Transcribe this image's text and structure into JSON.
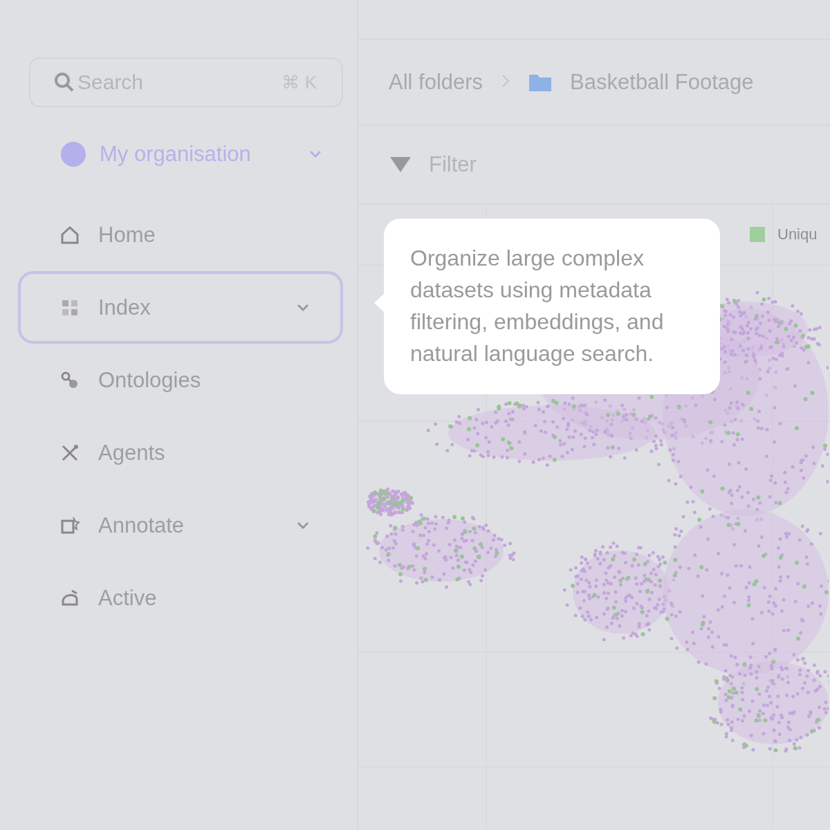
{
  "sidebar": {
    "search": {
      "placeholder": "Search",
      "shortcut": "⌘ K"
    },
    "organisation": {
      "label": "My organisation",
      "color": "#b3b0ec"
    },
    "items": [
      {
        "label": "Home",
        "selected": false,
        "expandable": false
      },
      {
        "label": "Index",
        "selected": true,
        "expandable": true
      },
      {
        "label": "Ontologies",
        "selected": false,
        "expandable": false
      },
      {
        "label": "Agents",
        "selected": false,
        "expandable": false
      },
      {
        "label": "Annotate",
        "selected": false,
        "expandable": true
      },
      {
        "label": "Active",
        "selected": false,
        "expandable": false
      }
    ]
  },
  "breadcrumb": [
    {
      "label": "All folders",
      "kind": "root"
    },
    {
      "label": "Basketball Footage",
      "kind": "folder"
    }
  ],
  "toolbar": {
    "filter": "Filter"
  },
  "plot": {
    "legend": [
      {
        "label": "Uniqu",
        "color": "#9fcf9c"
      }
    ]
  },
  "tooltip": {
    "text": "Organize large complex datasets using metadata filtering, embeddings, and natural language search."
  }
}
